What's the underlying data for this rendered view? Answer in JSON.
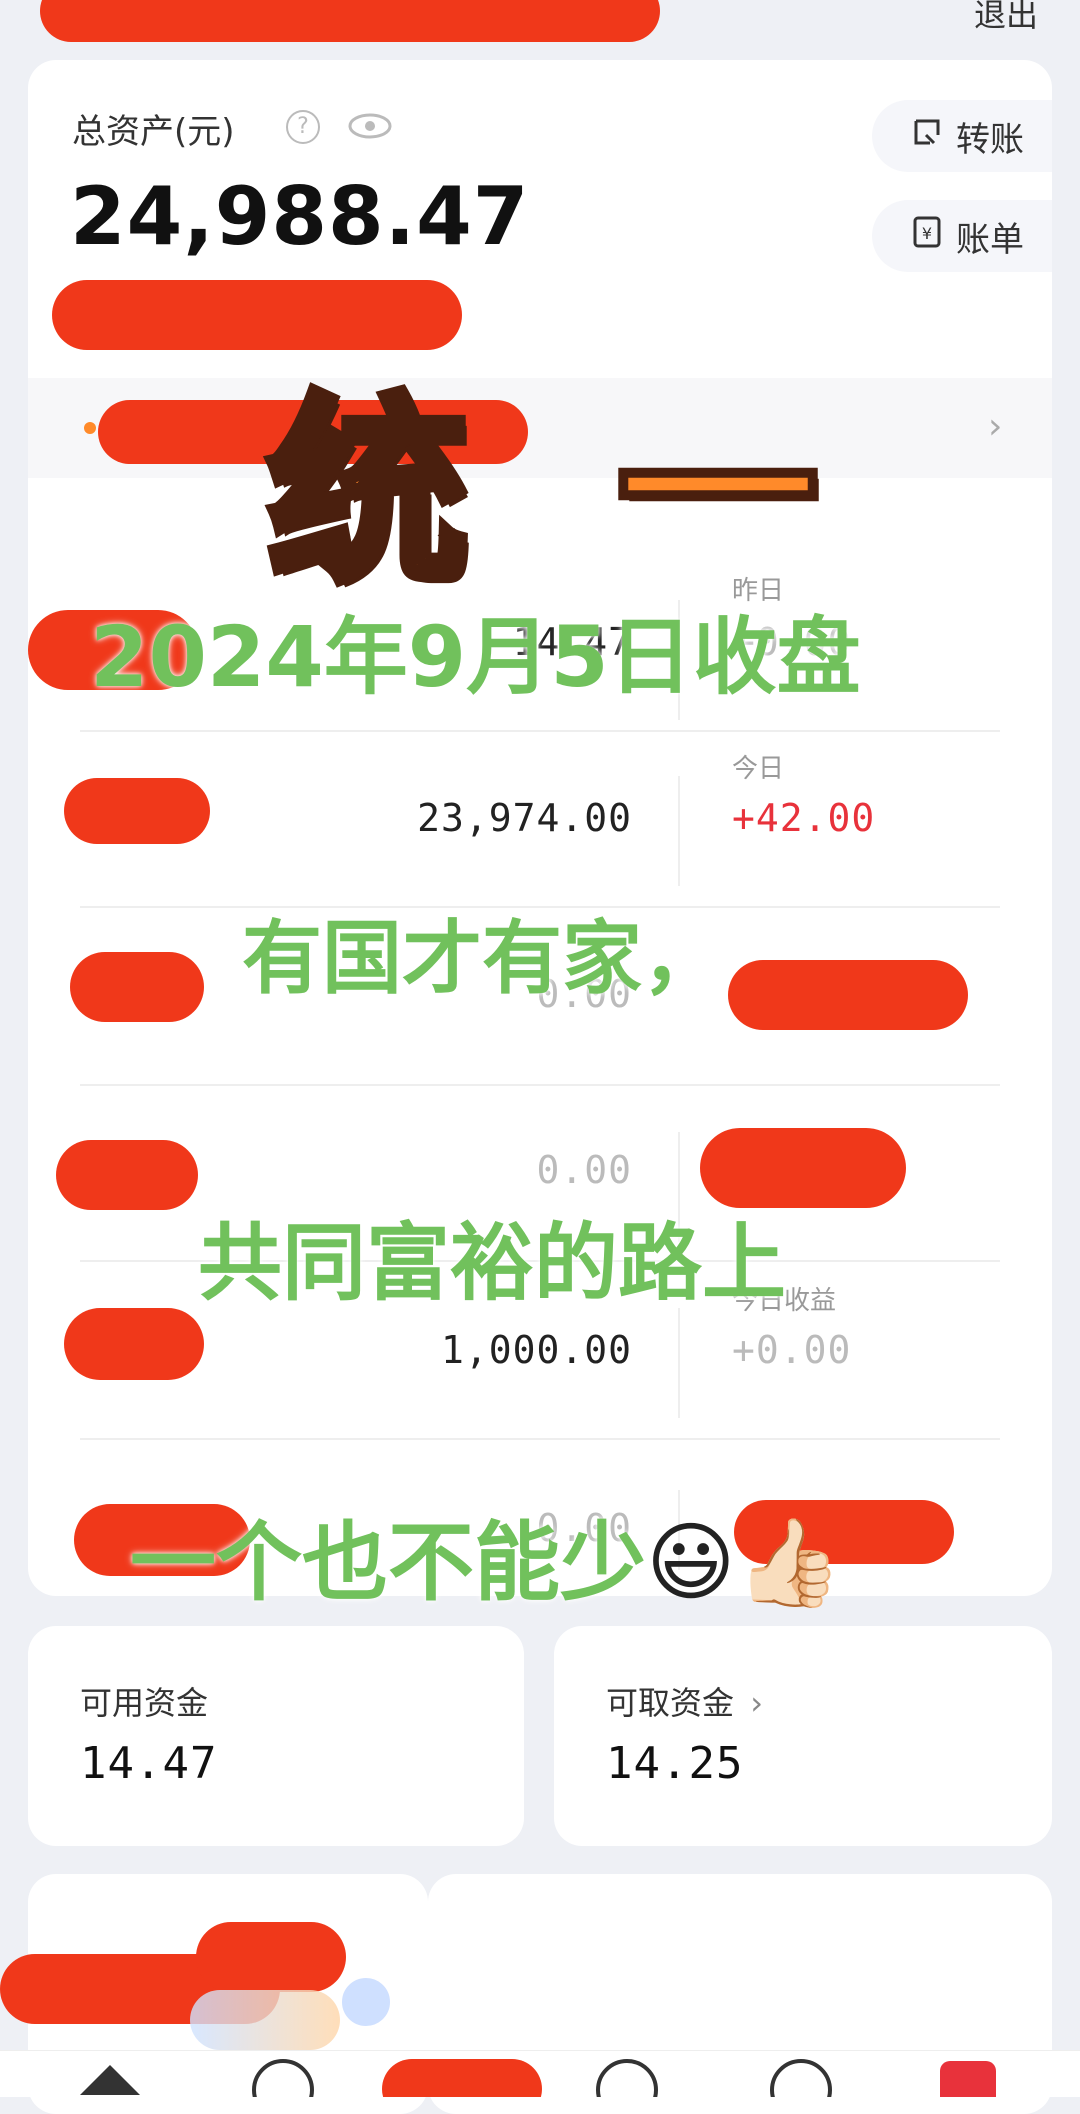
{
  "header": {
    "logout_label": "退出"
  },
  "assets": {
    "title": "总资产(元)",
    "total": "24,988.47",
    "transfer_label": "转账",
    "bill_label": "账单"
  },
  "rows": [
    {
      "value": "14.47",
      "side_label": "昨日",
      "side_value": "+0.00"
    },
    {
      "value": "23,974.00",
      "side_label": "今日",
      "side_value": "+42.00"
    },
    {
      "value": "0.00",
      "side_label": "",
      "side_value": ""
    },
    {
      "value": "0.00",
      "side_label": "",
      "side_value": ""
    },
    {
      "value": "1,000.00",
      "side_label": "今日收益",
      "side_value": "+0.00"
    },
    {
      "value": "0.00",
      "side_label": "",
      "side_value": ""
    }
  ],
  "funds": {
    "available_label": "可用资金",
    "available_value": "14.47",
    "withdrawable_label": "可取资金",
    "withdrawable_value": "14.25"
  },
  "overlay": {
    "big": "统 一",
    "date_line": "2024年9月5日收盘",
    "line1": "有国才有家，",
    "line2": "共同富裕的路上",
    "line3": "一个也不能少",
    "emoji": "😃👍🏻"
  },
  "colors": {
    "red": "#e8323b",
    "accent_orange": "#ff8a2a",
    "overlay_green": "#71c15c"
  },
  "icons": [
    "help-icon",
    "eye-icon",
    "transfer-icon",
    "bill-icon",
    "chevron-right-icon"
  ]
}
